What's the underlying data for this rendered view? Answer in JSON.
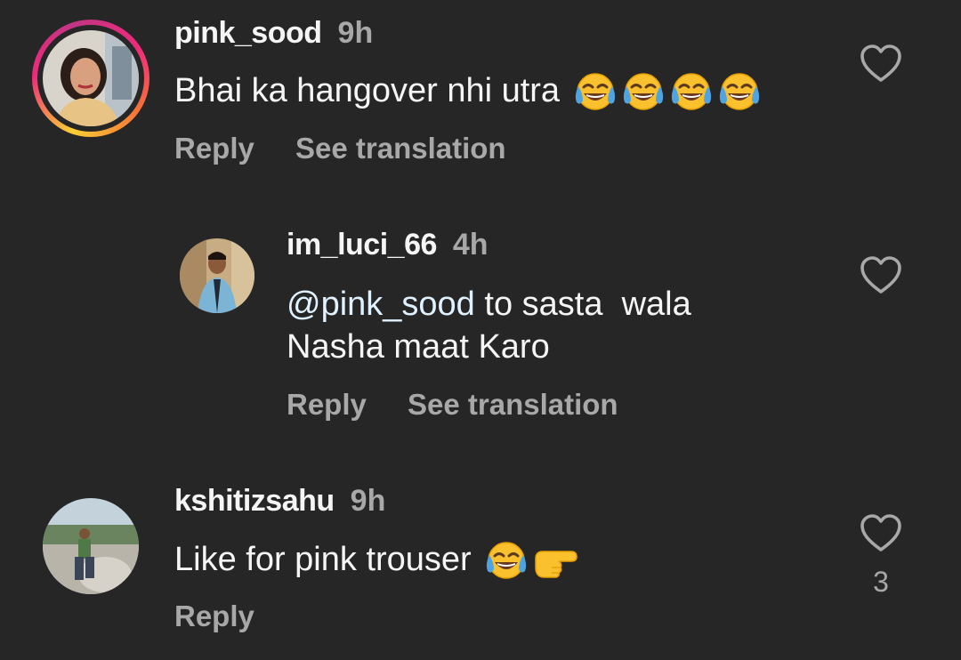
{
  "comments": [
    {
      "username": "pink_sood",
      "time": "9h",
      "text": "Bhai ka hangover nhi utra",
      "emoji": [
        "face-with-tears-of-joy",
        "face-with-tears-of-joy",
        "face-with-tears-of-joy",
        "face-with-tears-of-joy"
      ],
      "reply_label": "Reply",
      "translate_label": "See translation",
      "has_story_ring": true
    },
    {
      "username": "im_luci_66",
      "time": "4h",
      "mention": "@pink_sood",
      "text_line1": " to sasta  wala",
      "text_line2": "Nasha maat Karo",
      "reply_label": "Reply",
      "translate_label": "See translation"
    },
    {
      "username": "kshitizsahu",
      "time": "9h",
      "text": "Like for pink trouser",
      "emoji": [
        "face-with-tears-of-joy",
        "backhand-index-pointing-right"
      ],
      "reply_label": "Reply",
      "like_count": "3"
    }
  ],
  "colors": {
    "background": "#262626",
    "primary_text": "#f5f5f5",
    "secondary_text": "#a8a8a8",
    "mention": "#e0f1ff"
  }
}
